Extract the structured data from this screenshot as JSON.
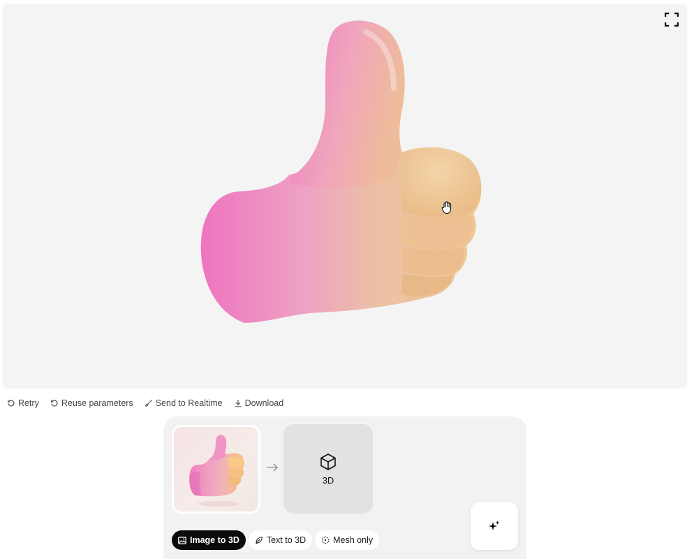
{
  "viewer": {
    "fullscreen_icon": "fullscreen-icon",
    "cursor_icon": "grab-hand-icon",
    "model_subject": "thumbs-up hand 3D model"
  },
  "actions": [
    {
      "label": "Retry",
      "icon": "retry-icon"
    },
    {
      "label": "Reuse parameters",
      "icon": "reuse-icon"
    },
    {
      "label": "Send to Realtime",
      "icon": "brush-icon"
    },
    {
      "label": "Download",
      "icon": "download-icon"
    }
  ],
  "composer": {
    "input_image": "thumbs-up-hand-image",
    "arrow_icon": "arrow-right-icon",
    "output_label": "3D",
    "output_icon": "cube-icon",
    "generate_icon": "sparkles-icon",
    "modes": [
      {
        "label": "Image to 3D",
        "icon": "image-icon",
        "active": true
      },
      {
        "label": "Text to 3D",
        "icon": "leaf-icon",
        "active": false
      },
      {
        "label": "Mesh only",
        "icon": "mesh-icon",
        "active": false
      }
    ]
  },
  "colors": {
    "viewport_bg": "#f4f4f4",
    "pink": "#ee78c2",
    "peach": "#efc48e",
    "active_pill": "#0a0a0a"
  }
}
